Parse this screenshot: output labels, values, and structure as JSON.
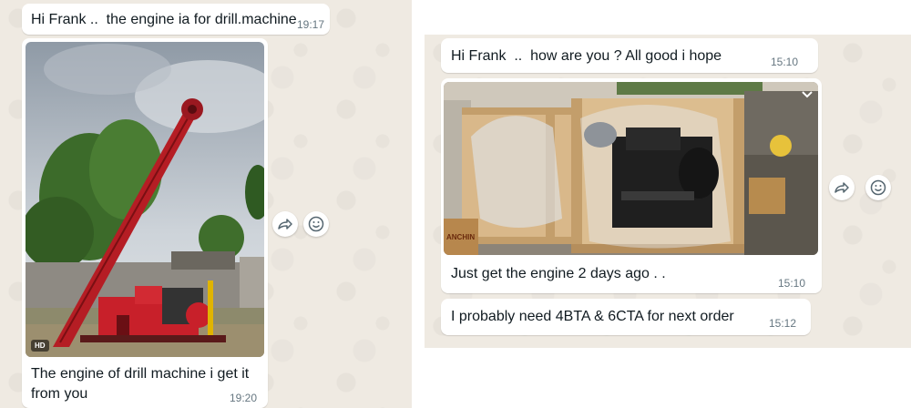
{
  "left_chat": {
    "msg1": {
      "text": "Hi Frank ..  the engine ia for drill.machine",
      "time": "19:17"
    },
    "image_msg": {
      "badge": "HD",
      "caption": "The engine of drill machine i get it from you",
      "time": "19:20"
    }
  },
  "right_chat": {
    "msg1": {
      "text": "Hi Frank  ..  how are you ? All good i hope",
      "time": "15:10"
    },
    "image_msg": {
      "caption": "Just get the engine 2 days ago . .",
      "time": "15:10",
      "crate_label": "ANCHIN"
    },
    "msg3": {
      "text": "I probably need 4BTA & 6CTA for next order",
      "time": "15:12"
    }
  },
  "icons": [
    "forward-icon",
    "emoji-reaction-icon",
    "chevron-down-icon"
  ]
}
